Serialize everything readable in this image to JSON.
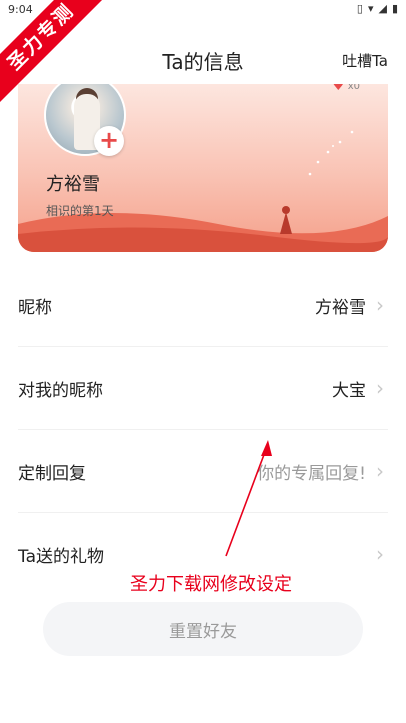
{
  "status_bar": {
    "time": "9:04"
  },
  "watermark": {
    "ribbon": "圣力专测",
    "caption": "圣力下载网修改设定"
  },
  "header": {
    "title": "Ta的信息",
    "action": "吐槽Ta"
  },
  "profile": {
    "name": "方裕雪",
    "days_label": "相识的第1天",
    "badge_count": "x0"
  },
  "rows": [
    {
      "label": "昵称",
      "value": "方裕雪",
      "placeholder": false
    },
    {
      "label": "对我的昵称",
      "value": "大宝",
      "placeholder": false
    },
    {
      "label": "定制回复",
      "value": "你的专属回复!",
      "placeholder": true
    },
    {
      "label": "Ta送的礼物",
      "value": "",
      "placeholder": false
    }
  ],
  "reset_button": {
    "label": "重置好友"
  },
  "colors": {
    "accent": "#e84a4a",
    "ribbon": "#e8001c",
    "card_bottom": "#f5a08a"
  }
}
